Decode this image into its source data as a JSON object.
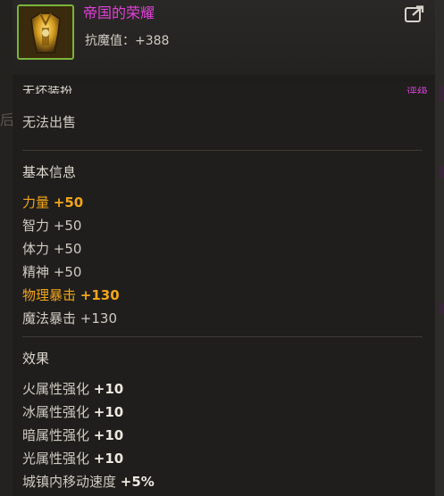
{
  "item": {
    "name": "帝国的荣耀",
    "resist_label": "抗魔值：",
    "resist_value": "+388"
  },
  "header_cut": {
    "left": "无坏装扮",
    "right": "评级"
  },
  "sale": "无法出售",
  "basic": {
    "heading": "基本信息",
    "stats": [
      {
        "label": "力量",
        "value": "+50",
        "highlight": true
      },
      {
        "label": "智力",
        "value": "+50",
        "highlight": false
      },
      {
        "label": "体力",
        "value": "+50",
        "highlight": false
      },
      {
        "label": "精神",
        "value": "+50",
        "highlight": false
      },
      {
        "label": "物理暴击",
        "value": "+130",
        "highlight": true
      },
      {
        "label": "魔法暴击",
        "value": "+130",
        "highlight": false
      }
    ]
  },
  "effects": {
    "heading": "效果",
    "stats": [
      {
        "label": "火属性强化",
        "value": "+10"
      },
      {
        "label": "冰属性强化",
        "value": "+10"
      },
      {
        "label": "暗属性强化",
        "value": "+10"
      },
      {
        "label": "光属性强化",
        "value": "+10"
      },
      {
        "label": "城镇内移动速度",
        "value": "+5%"
      }
    ]
  },
  "background": {
    "left_glyph": "后"
  },
  "colors": {
    "item_name": "#e040d8",
    "highlight": "#f2a51a",
    "icon_border": "#7bb33a"
  },
  "icons": {
    "item": "golden-armor-icon",
    "share": "external-link-icon"
  }
}
